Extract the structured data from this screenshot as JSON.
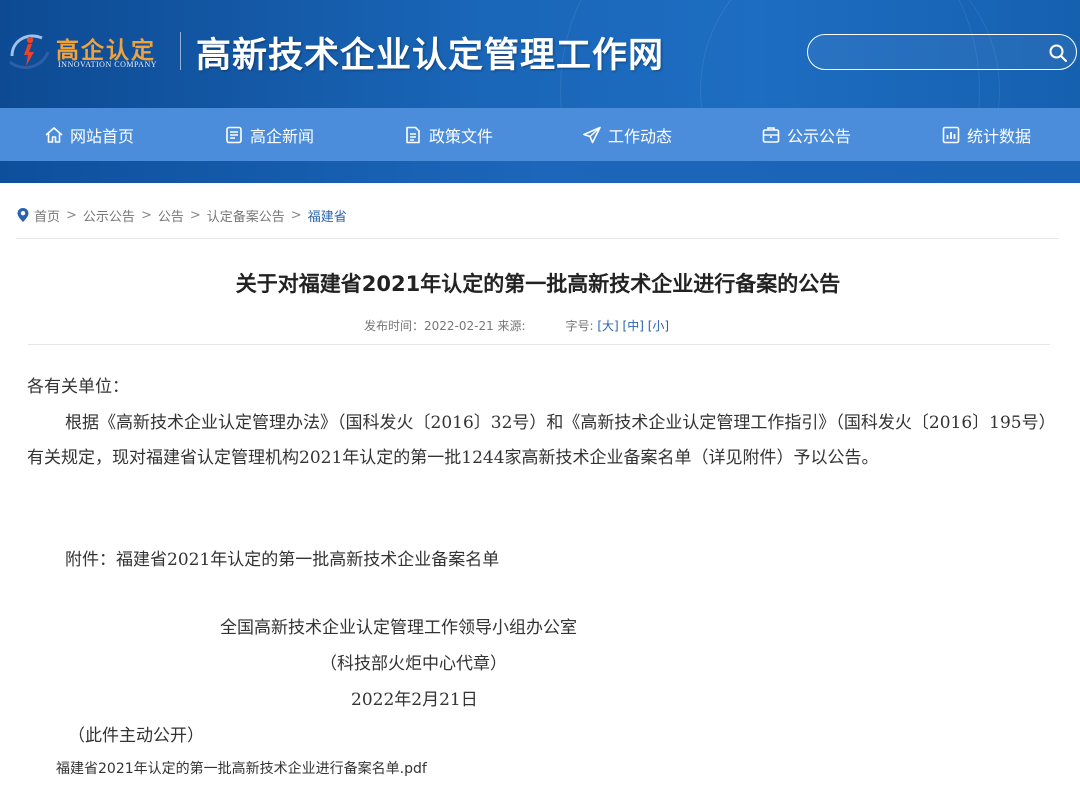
{
  "header": {
    "logo_cn": "高企认定",
    "logo_en": "INNOVATION COMPANY",
    "site_title": "高新技术企业认定管理工作网",
    "search_placeholder": "",
    "brand_color": "#1a66b8",
    "nav_color": "#4b8ddb"
  },
  "nav": {
    "items": [
      {
        "label": "网站首页",
        "icon": "home-icon"
      },
      {
        "label": "高企新闻",
        "icon": "news-icon"
      },
      {
        "label": "政策文件",
        "icon": "document-icon"
      },
      {
        "label": "工作动态",
        "icon": "paper-plane-icon"
      },
      {
        "label": "公示公告",
        "icon": "announcement-icon"
      },
      {
        "label": "统计数据",
        "icon": "chart-icon"
      }
    ]
  },
  "breadcrumb": {
    "items": [
      "首页",
      "公示公告",
      "公告",
      "认定备案公告"
    ],
    "current": "福建省",
    "separator": ">"
  },
  "article": {
    "title": "关于对福建省2021年认定的第一批高新技术企业进行备案的公告",
    "meta_publish": "发布时间：2022-02-21 来源:",
    "meta_font_label": "字号:",
    "font_sizes": [
      "[大]",
      "[中]",
      "[小]"
    ],
    "salutation": "各有关单位：",
    "paragraph": "根据《高新技术企业认定管理办法》（国科发火〔2016〕32号）和《高新技术企业认定管理工作指引》（国科发火〔2016〕195号）有关规定，现对福建省认定管理机构2021年认定的第一批1244家高新技术企业备案名单（详见附件）予以公告。",
    "attachment_line": "附件：福建省2021年认定的第一批高新技术企业备案名单",
    "signature_org": "全国高新技术企业认定管理工作领导小组办公室",
    "signature_agent": "（科技部火炬中心代章）",
    "signature_date": "2022年2月21日",
    "disclosure": "（此件主动公开）",
    "attachment_file": "福建省2021年认定的第一批高新技术企业进行备案名单.pdf"
  }
}
